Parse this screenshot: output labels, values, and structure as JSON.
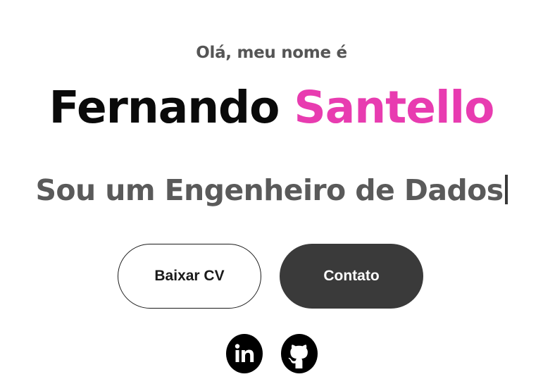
{
  "hero": {
    "greeting": "Olá, meu nome é",
    "first_name": "Fernando",
    "last_name": "Santello",
    "subtitle": "Sou um Engenheiro de Dados"
  },
  "buttons": {
    "download_cv": "Baixar CV",
    "contact": "Contato"
  },
  "social": {
    "linkedin_text": "in",
    "icons": [
      "linkedin-icon",
      "github-icon"
    ]
  },
  "colors": {
    "accent": "#e83cb0",
    "name_primary": "#0a0a0a",
    "dark_button": "#3a3a3a",
    "subtitle": "#5a5a5a"
  }
}
